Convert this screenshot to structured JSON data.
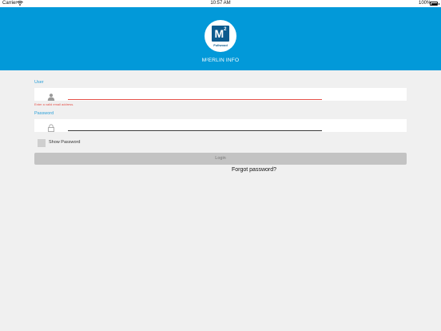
{
  "status_bar": {
    "carrier": "Carrier",
    "time": "10:57 AM",
    "battery": "100%"
  },
  "header": {
    "logo_mark": "M",
    "logo_superscript": "2",
    "logo_brand": "Fullwood",
    "app_title": "M²ERLIN INFO",
    "background_color": "#0299d9"
  },
  "form": {
    "user": {
      "label": "User",
      "value": "",
      "placeholder": "",
      "icon": "person-icon",
      "error": "Enter a valid email address.",
      "underline_color": "#e5534b"
    },
    "password": {
      "label": "Password",
      "value": "",
      "placeholder": "",
      "icon": "lock-icon",
      "underline_color": "#333333"
    },
    "show_password": {
      "label": "Show Password",
      "checked": false
    },
    "login_label": "Login",
    "forgot_label": "Forgot password?"
  }
}
